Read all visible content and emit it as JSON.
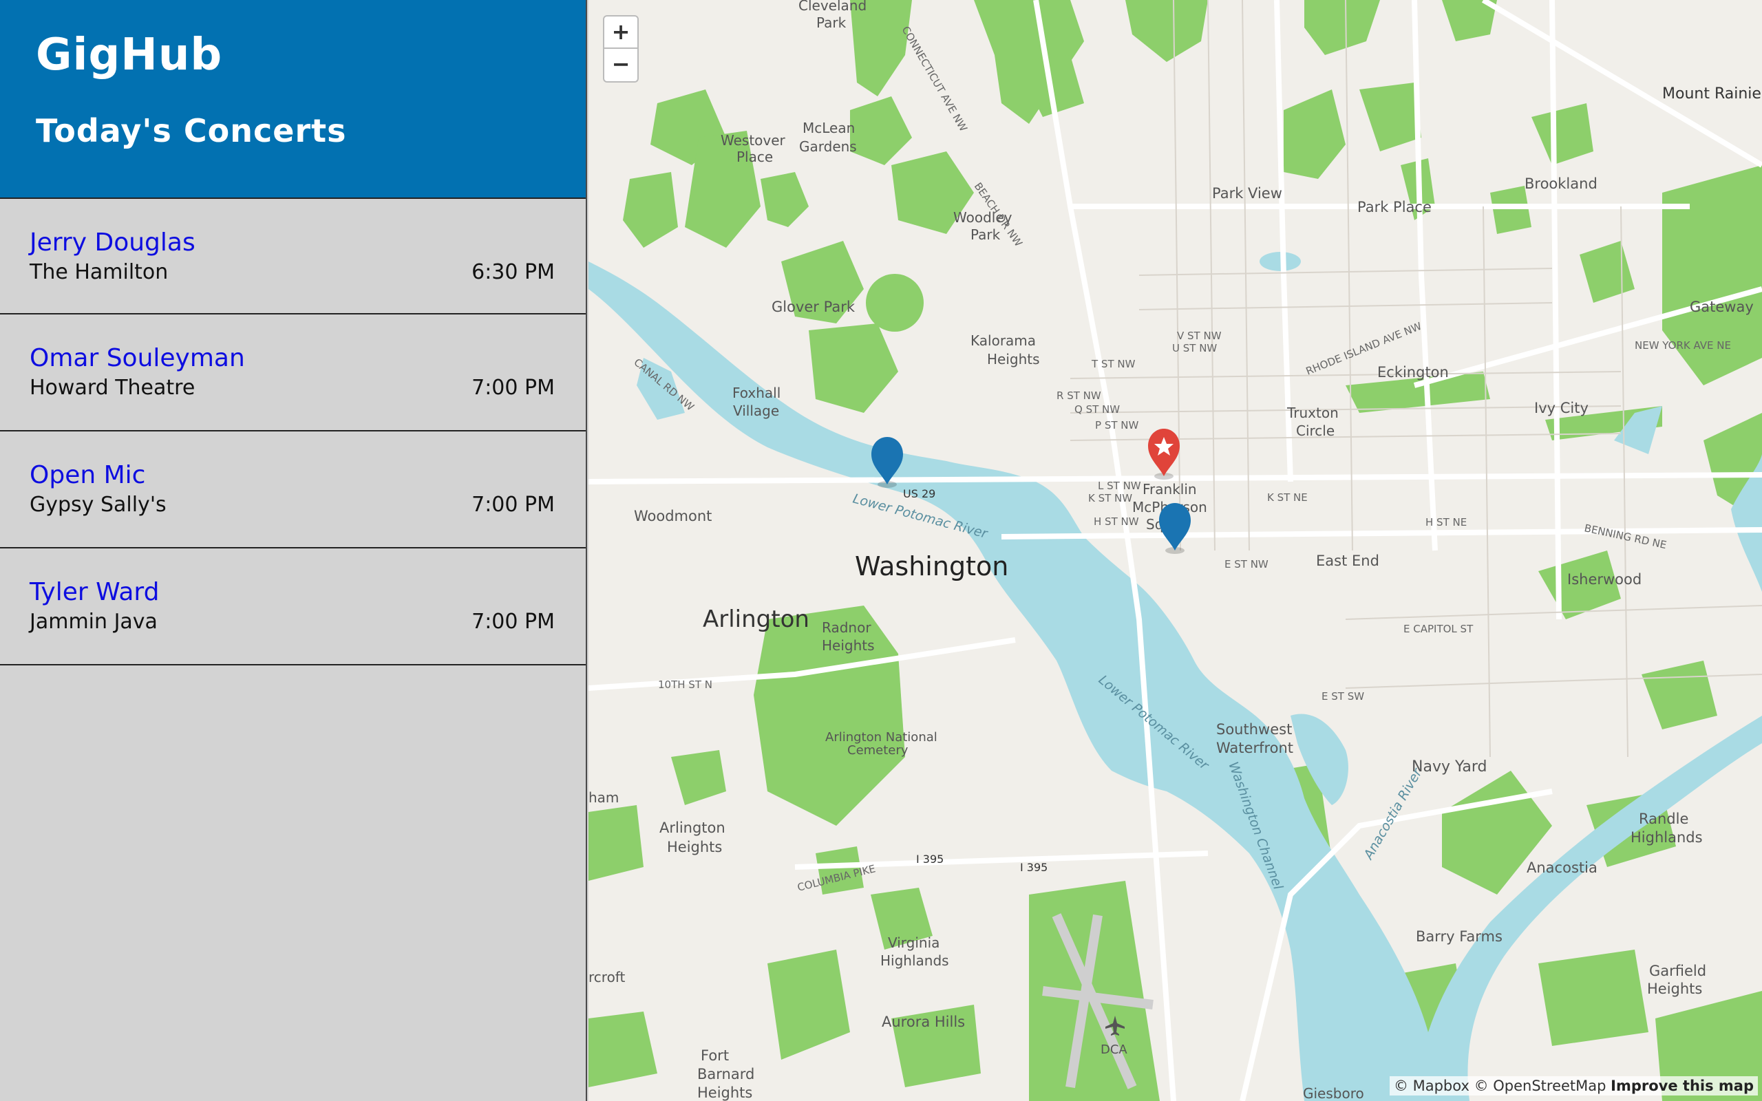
{
  "sidebar": {
    "app_title": "GigHub",
    "list_title": "Today's Concerts",
    "concerts": [
      {
        "artist": "Jerry Douglas",
        "venue": "The Hamilton",
        "time": "6:30 PM"
      },
      {
        "artist": "Omar Souleyman",
        "venue": "Howard Theatre",
        "time": "7:00 PM"
      },
      {
        "artist": "Open Mic",
        "venue": "Gypsy Sally's",
        "time": "7:00 PM"
      },
      {
        "artist": "Tyler Ward",
        "venue": "Jammin Java",
        "time": "7:00 PM"
      }
    ]
  },
  "map": {
    "zoom_in": "+",
    "zoom_out": "−",
    "attribution": "© Mapbox © OpenStreetMap",
    "improve": "Improve this map",
    "labels": {
      "washington": "Washington",
      "arlington": "Arlington",
      "cleveland_park_1": "Cleveland",
      "cleveland_park_2": "Park",
      "mount_rainier": "Mount Rainier",
      "westover_1": "Westover",
      "westover_2": "Place",
      "mclean_1": "McLean",
      "mclean_2": "Gardens",
      "woodley_1": "Woodley",
      "woodley_2": "Park",
      "park_view": "Park View",
      "brookland": "Brookland",
      "park_place": "Park Place",
      "gateway": "Gateway",
      "glover_park": "Glover Park",
      "kalorama_1": "Kalorama",
      "kalorama_2": "Heights",
      "eckington": "Eckington",
      "foxhall_1": "Foxhall",
      "foxhall_2": "Village",
      "ivy_city": "Ivy City",
      "truxton_1": "Truxton",
      "truxton_2": "Circle",
      "franklin_1": "Franklin",
      "franklin_2": "McPherson",
      "franklin_3": "Sq",
      "woodmont": "Woodmont",
      "east_end": "East End",
      "isherwood": "Isherwood",
      "radnor_1": "Radnor",
      "radnor_2": "Heights",
      "cemetery_1": "Arlington National",
      "cemetery_2": "Cemetery",
      "sw_waterfront_1": "Southwest",
      "sw_waterfront_2": "Waterfront",
      "navy_yard": "Navy Yard",
      "randle_1": "Randle",
      "randle_2": "Highlands",
      "arlington_heights_1": "Arlington",
      "arlington_heights_2": "Heights",
      "anacostia": "Anacostia",
      "virginia_1": "Virginia",
      "virginia_2": "Highlands",
      "barry_farms": "Barry Farms",
      "garfield_1": "Garfield",
      "garfield_2": "Heights",
      "aurora_hills": "Aurora Hills",
      "fort_barnard_1": "Fort",
      "fort_barnard_2": "Barnard",
      "fort_barnard_3": "Heights",
      "dca": "DCA",
      "giesboro": "Giesboro",
      "crcroft": "rcroft",
      "ham": "ham",
      "river_potomac": "Lower Potomac River",
      "river_anacostia": "Anacostia River",
      "washington_channel": "Washington Channel",
      "us29": "US 29",
      "i395_a": "I 395",
      "i395_b": "I 395",
      "e_capitol": "E CAPITOL ST",
      "e_st_nw": "E ST NW",
      "e_st_sw": "E ST SW",
      "k_st_ne": "K ST NE",
      "h_st_ne": "H ST NE",
      "l_st_nw": "L ST NW",
      "k_st_nw": "K ST NW",
      "h_st_nw": "H ST NW",
      "r_st_nw": "R ST NW",
      "q_st_nw": "Q ST NW",
      "p_st_nw": "P ST NW",
      "t_st_nw": "T ST NW",
      "u_st_nw": "U ST NW",
      "v_st_nw": "V ST NW",
      "rhode_island": "RHODE ISLAND AVE NW",
      "new_york": "NEW YORK AVE NE",
      "benning": "BENNING RD NE",
      "canal": "CANAL RD NW",
      "connecticut": "CONNECTICUT AVE NW",
      "beach": "BEACH DR NW",
      "columbia_pike": "COLUMBIA PIKE",
      "tenth_st": "10TH ST N"
    },
    "markers": [
      {
        "name": "gypsy-sallys",
        "color": "#1a74b2",
        "kind": "venue"
      },
      {
        "name": "current-location",
        "color": "#e0443a",
        "kind": "star"
      },
      {
        "name": "the-hamilton",
        "color": "#1a74b2",
        "kind": "venue"
      }
    ],
    "colors": {
      "land": "#f1efea",
      "park": "#8dcf6b",
      "water": "#a9dbe4",
      "road": "#ffffff"
    }
  }
}
